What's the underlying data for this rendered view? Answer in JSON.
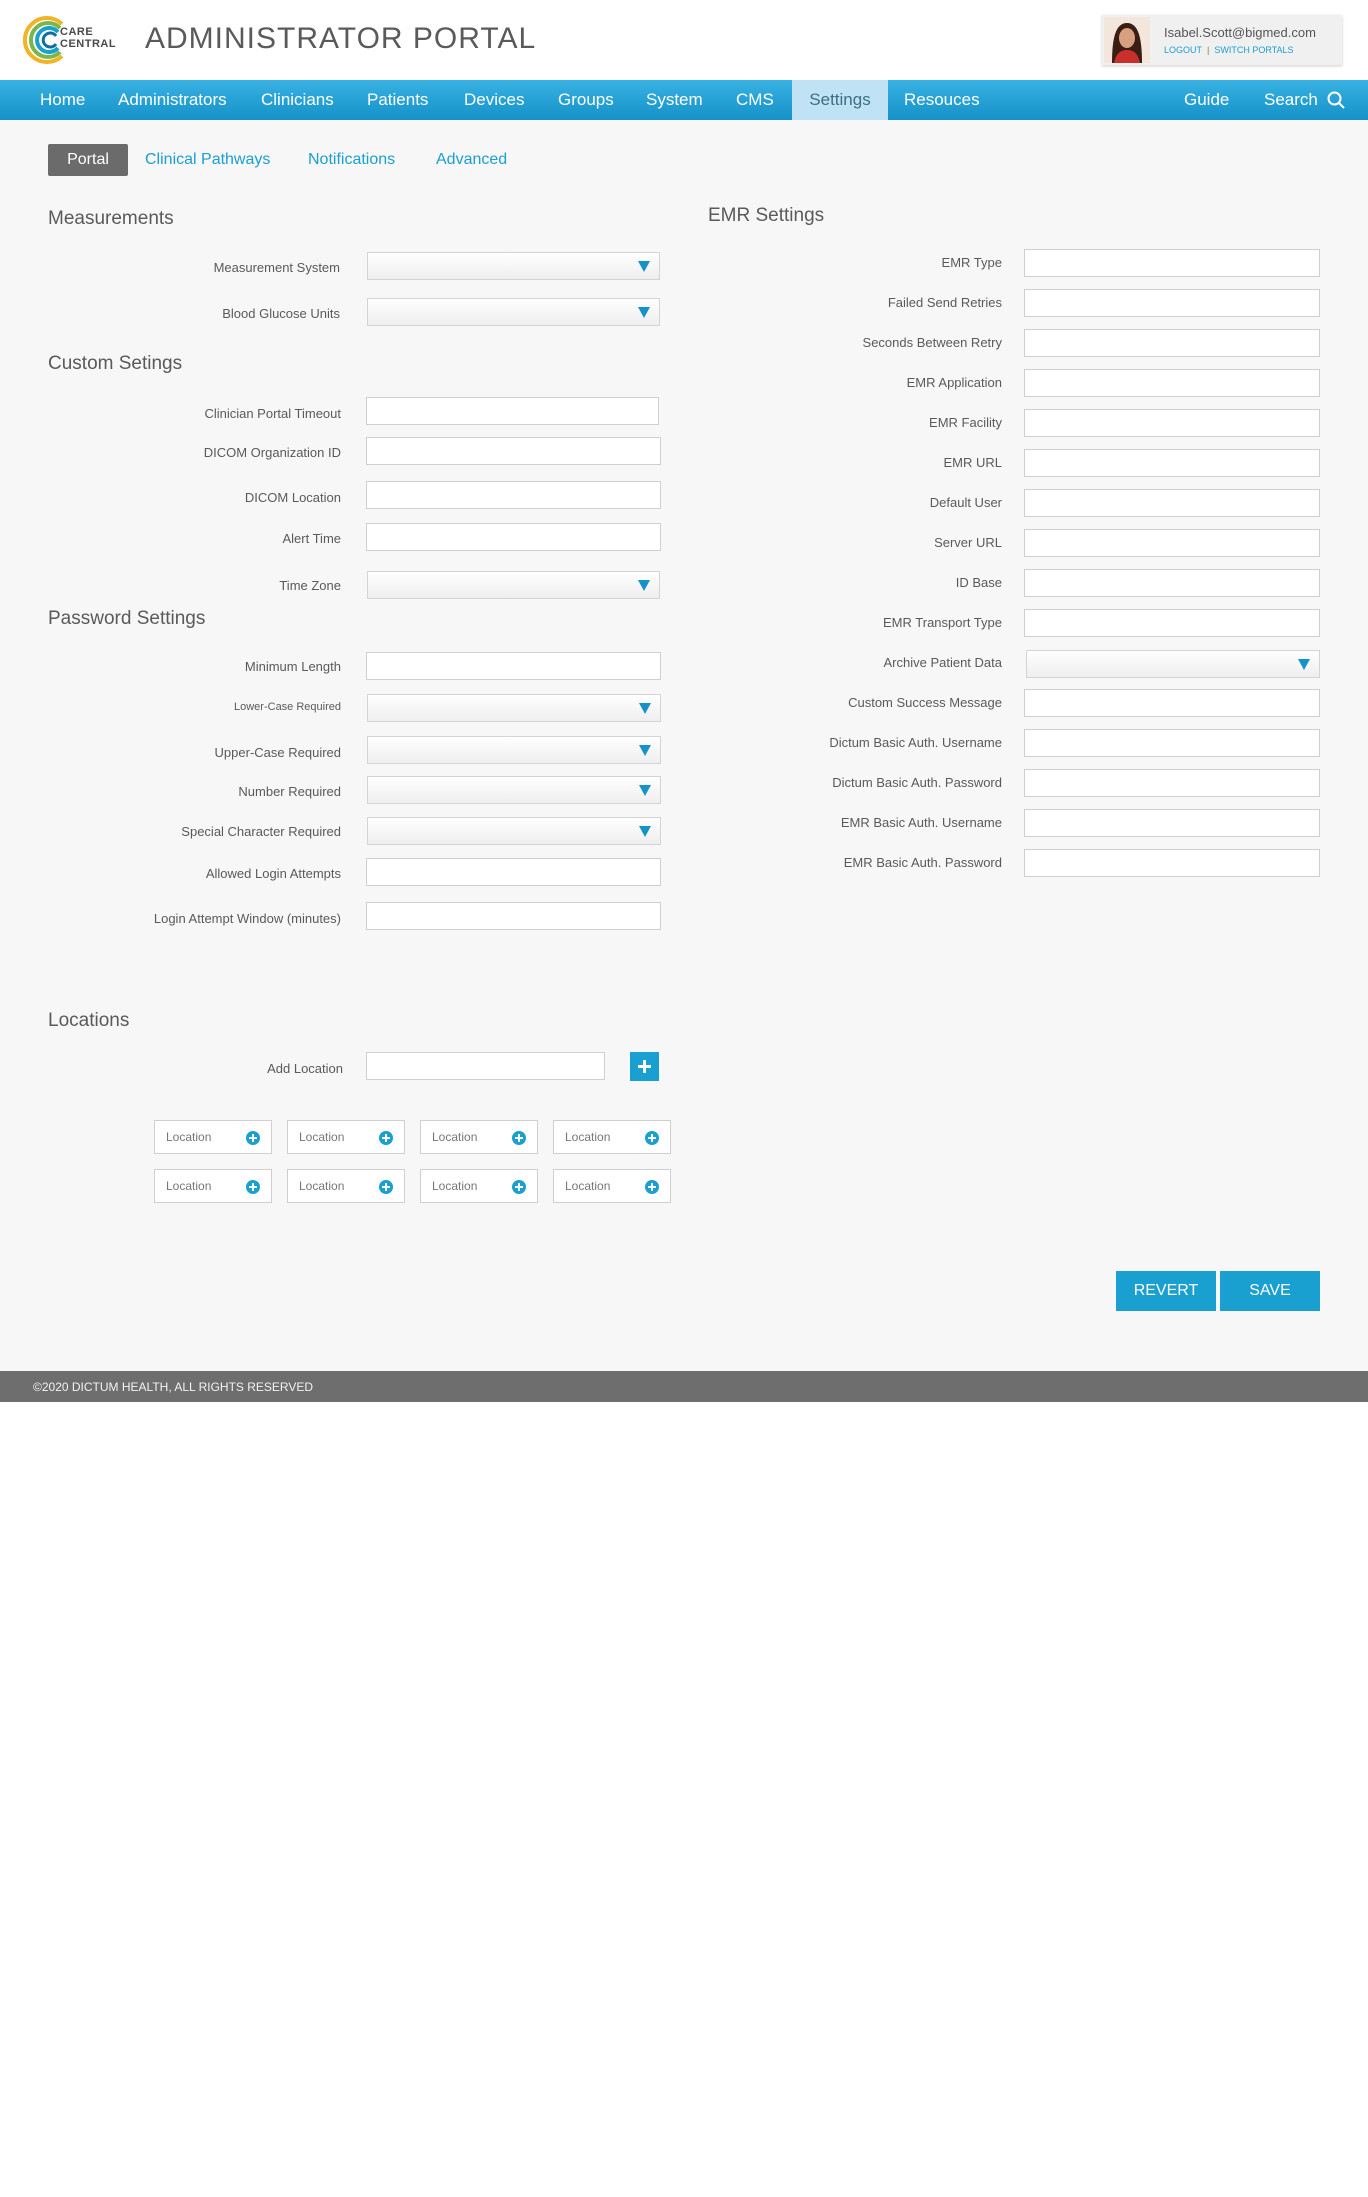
{
  "header": {
    "logo_line1": "CARE",
    "logo_line2": "CENTRAL",
    "title": "ADMINISTRATOR PORTAL",
    "user_email": "Isabel.Scott@bigmed.com",
    "logout": "LOGOUT",
    "separator": "|",
    "switch_portals": "SWITCH PORTALS"
  },
  "nav": {
    "home": "Home",
    "administrators": "Administrators",
    "clinicians": "Clinicians",
    "patients": "Patients",
    "devices": "Devices",
    "groups": "Groups",
    "system": "System",
    "cms": "CMS",
    "settings": "Settings",
    "resources": "Resouces",
    "guide": "Guide",
    "search": "Search"
  },
  "subtabs": {
    "portal": "Portal",
    "clinical_pathways": "Clinical Pathways",
    "notifications": "Notifications",
    "advanced": "Advanced"
  },
  "measurements": {
    "title": "Measurements",
    "measurement_system": "Measurement System",
    "blood_glucose_units": "Blood Glucose Units"
  },
  "custom": {
    "title": "Custom Setings",
    "clinician_portal_timeout": "Clinician Portal Timeout",
    "dicom_org_id": "DICOM Organization ID",
    "dicom_location": "DICOM Location",
    "alert_time": "Alert Time",
    "time_zone": "Time Zone"
  },
  "password": {
    "title": "Password Settings",
    "minimum_length": "Minimum Length",
    "lower_case": "Lower-Case Required",
    "upper_case": "Upper-Case Required",
    "number": "Number Required",
    "special": "Special Character Required",
    "login_attempts": "Allowed Login Attempts",
    "login_window": "Login Attempt Window (minutes)"
  },
  "locations": {
    "title": "Locations",
    "add_location": "Add Location",
    "chip": "Location"
  },
  "emr": {
    "title": "EMR Settings",
    "emr_type": "EMR Type",
    "failed_retries": "Failed Send Retries",
    "seconds_between": "Seconds Between Retry",
    "emr_application": "EMR Application",
    "emr_facility": "EMR Facility",
    "emr_url": "EMR URL",
    "default_user": "Default User",
    "server_url": "Server URL",
    "id_base": "ID Base",
    "transport_type": "EMR Transport Type",
    "archive_patient": "Archive Patient Data",
    "custom_success": "Custom Success Message",
    "dictum_username": "Dictum Basic Auth. Username",
    "dictum_password": "Dictum Basic Auth. Password",
    "emr_username": "EMR Basic Auth. Username",
    "emr_password": "EMR Basic Auth. Password"
  },
  "actions": {
    "revert": "REVERT",
    "save": "SAVE"
  },
  "footer": {
    "copyright": "©2020 DICTUM HEALTH, ALL RIGHTS RESERVED"
  }
}
